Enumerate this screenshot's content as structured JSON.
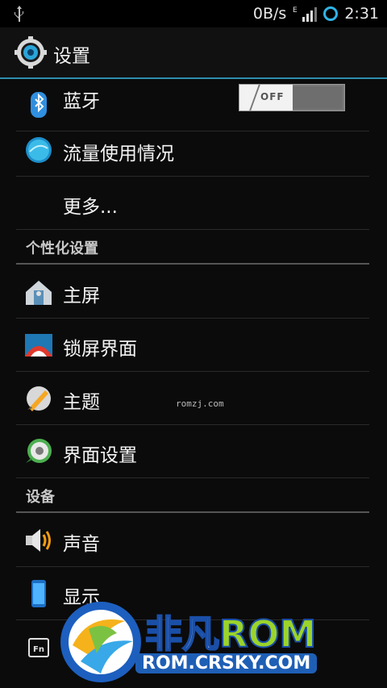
{
  "statusbar": {
    "speed": "0B/s",
    "time": "2:31",
    "network_letter": "E"
  },
  "actionbar": {
    "title": "设置"
  },
  "items": {
    "bluetooth": {
      "label": "蓝牙",
      "toggle": "OFF"
    },
    "data_usage": {
      "label": "流量使用情况"
    },
    "more": {
      "label": "更多..."
    }
  },
  "sections": {
    "personal": "个性化设置",
    "device": "设备"
  },
  "personal_items": {
    "home": {
      "label": "主屏"
    },
    "lockscreen": {
      "label": "锁屏界面"
    },
    "theme": {
      "label": "主题"
    },
    "ui": {
      "label": "界面设置"
    }
  },
  "device_items": {
    "sound": {
      "label": "声音"
    },
    "display": {
      "label": "显示"
    }
  },
  "watermark": {
    "small": "romzj.com",
    "brand_chars": "非凡",
    "brand_rom": "ROM",
    "brand_url": "ROM.CRSKY.COM"
  },
  "colors": {
    "accent": "#2d8fb0",
    "background": "#0b0b0b"
  }
}
